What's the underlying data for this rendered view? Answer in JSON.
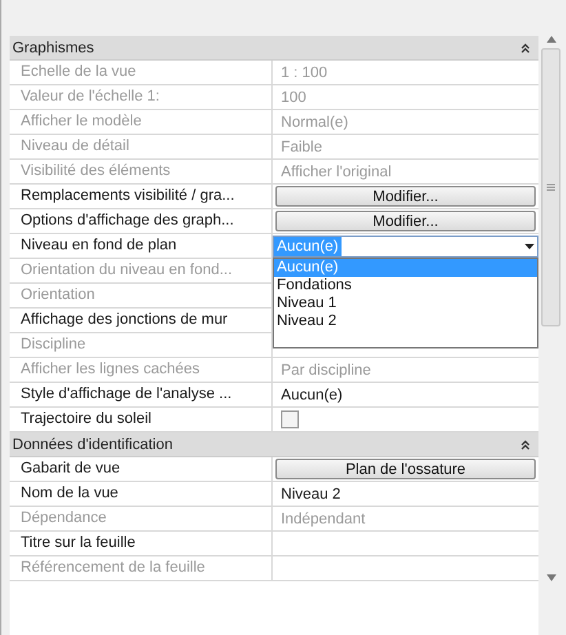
{
  "sections": [
    {
      "title": "Graphismes",
      "expanded": true,
      "rows": [
        {
          "label": "Echelle de la vue",
          "kind": "text",
          "disabled": true,
          "value": "1 : 100"
        },
        {
          "label": "Valeur de l'échelle    1:",
          "kind": "text",
          "disabled": true,
          "value": "100"
        },
        {
          "label": "Afficher le modèle",
          "kind": "text",
          "disabled": true,
          "value": "Normal(e)"
        },
        {
          "label": "Niveau de détail",
          "kind": "text",
          "disabled": true,
          "value": "Faible"
        },
        {
          "label": "Visibilité des éléments",
          "kind": "text",
          "disabled": true,
          "value": "Afficher l'original"
        },
        {
          "label": "Remplacements visibilité / gra...",
          "kind": "button",
          "disabled": false,
          "value": "Modifier..."
        },
        {
          "label": "Options d'affichage des graph...",
          "kind": "button",
          "disabled": false,
          "value": "Modifier..."
        },
        {
          "label": "Niveau en fond de plan",
          "kind": "combo",
          "disabled": false,
          "value": "Aucun(e)",
          "expanded": true,
          "options": [
            {
              "label": "Aucun(e)",
              "selected": true
            },
            {
              "label": "Fondations",
              "selected": false
            },
            {
              "label": "Niveau 1",
              "selected": false
            },
            {
              "label": "Niveau 2",
              "selected": false
            }
          ]
        },
        {
          "label": "Orientation du niveau en fond...",
          "kind": "text",
          "disabled": true
        },
        {
          "label": "Orientation",
          "kind": "text",
          "disabled": true
        },
        {
          "label": "Affichage des jonctions de mur",
          "kind": "text",
          "disabled": false
        },
        {
          "label": "Discipline",
          "kind": "text",
          "disabled": true
        },
        {
          "label": "Afficher les lignes cachées",
          "kind": "text",
          "disabled": true,
          "value": "Par discipline"
        },
        {
          "label": "Style d'affichage de l'analyse ...",
          "kind": "text",
          "disabled": false,
          "value": "Aucun(e)"
        },
        {
          "label": "Trajectoire du soleil",
          "kind": "checkbox",
          "disabled": false,
          "checked": false
        }
      ]
    },
    {
      "title": "Données d'identification",
      "expanded": true,
      "rows": [
        {
          "label": "Gabarit de vue",
          "kind": "button",
          "disabled": false,
          "value": "Plan de l'ossature"
        },
        {
          "label": "Nom de la vue",
          "kind": "text",
          "disabled": false,
          "value": "Niveau 2"
        },
        {
          "label": "Dépendance",
          "kind": "text",
          "disabled": true,
          "value": "Indépendant"
        },
        {
          "label": "Titre sur la feuille",
          "kind": "text",
          "disabled": false
        },
        {
          "label": "Référencement de la feuille",
          "kind": "text",
          "disabled": true
        }
      ]
    }
  ]
}
